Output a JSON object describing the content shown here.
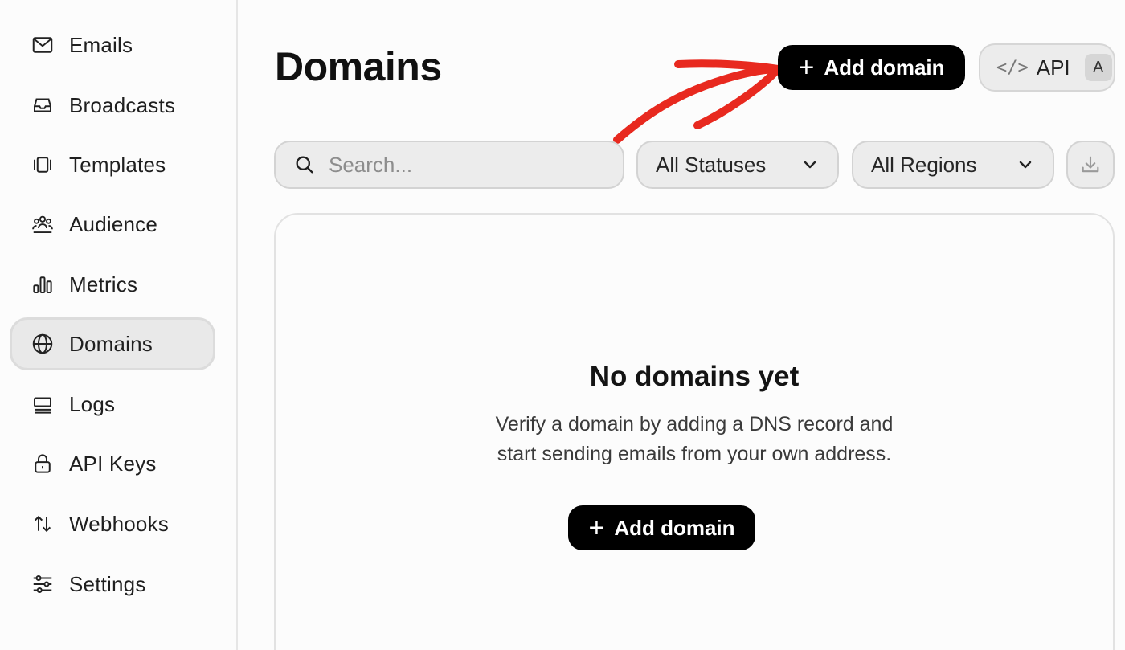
{
  "sidebar": {
    "items": [
      {
        "label": "Emails",
        "icon": "mail-icon",
        "active": false
      },
      {
        "label": "Broadcasts",
        "icon": "inbox-icon",
        "active": false
      },
      {
        "label": "Templates",
        "icon": "templates-icon",
        "active": false
      },
      {
        "label": "Audience",
        "icon": "users-icon",
        "active": false
      },
      {
        "label": "Metrics",
        "icon": "bar-chart-icon",
        "active": false
      },
      {
        "label": "Domains",
        "icon": "globe-icon",
        "active": true
      },
      {
        "label": "Logs",
        "icon": "logs-icon",
        "active": false
      },
      {
        "label": "API Keys",
        "icon": "lock-icon",
        "active": false
      },
      {
        "label": "Webhooks",
        "icon": "arrows-up-down-icon",
        "active": false
      },
      {
        "label": "Settings",
        "icon": "sliders-icon",
        "active": false
      }
    ]
  },
  "header": {
    "title": "Domains",
    "add_button_label": "Add domain",
    "api_button_label": "API",
    "api_shortcut": "A"
  },
  "filters": {
    "search_placeholder": "Search...",
    "status_select": "All Statuses",
    "region_select": "All Regions"
  },
  "empty_state": {
    "title": "No domains yet",
    "description_line1": "Verify a domain by adding a DNS record and",
    "description_line2": "start sending emails from your own address.",
    "button_label": "Add domain"
  },
  "colors": {
    "primary_button": "#000000",
    "annotation_arrow": "#e8291f",
    "active_nav_bg": "#e9e9e9"
  }
}
